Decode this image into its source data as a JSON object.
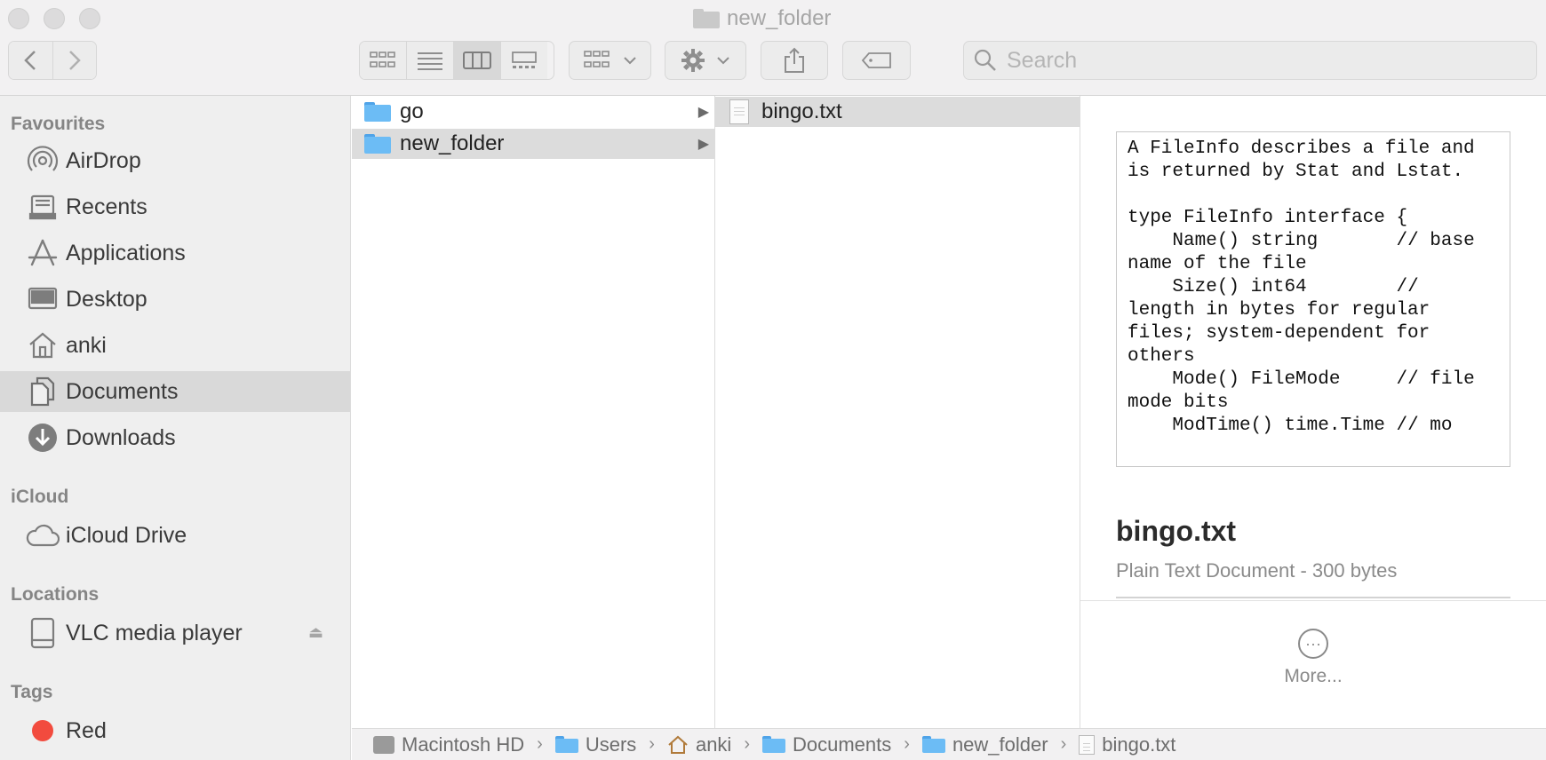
{
  "window": {
    "title": "new_folder"
  },
  "toolbar": {
    "search_placeholder": "Search"
  },
  "sidebar": {
    "sections": [
      {
        "title": "Favourites"
      },
      {
        "title": "iCloud"
      },
      {
        "title": "Locations"
      },
      {
        "title": "Tags"
      }
    ],
    "favourites": [
      {
        "label": "AirDrop",
        "icon": "airdrop-icon"
      },
      {
        "label": "Recents",
        "icon": "recents-icon"
      },
      {
        "label": "Applications",
        "icon": "applications-icon"
      },
      {
        "label": "Desktop",
        "icon": "desktop-icon"
      },
      {
        "label": "anki",
        "icon": "home-icon"
      },
      {
        "label": "Documents",
        "icon": "documents-icon",
        "selected": true
      },
      {
        "label": "Downloads",
        "icon": "downloads-icon"
      }
    ],
    "icloud": [
      {
        "label": "iCloud Drive",
        "icon": "cloud-icon"
      }
    ],
    "locations": [
      {
        "label": "VLC media player",
        "icon": "disk-icon"
      }
    ],
    "tags": [
      {
        "label": "Red",
        "color": "#f24b3e"
      }
    ]
  },
  "columns": {
    "col1": [
      {
        "name": "go"
      },
      {
        "name": "new_folder",
        "selected": true
      }
    ],
    "col2": [
      {
        "name": "bingo.txt",
        "selected": true
      }
    ]
  },
  "preview": {
    "text": "A FileInfo describes a file and\nis returned by Stat and Lstat.\n\ntype FileInfo interface {\n    Name() string       // base\nname of the file\n    Size() int64        //\nlength in bytes for regular\nfiles; system-dependent for\nothers\n    Mode() FileMode     // file\nmode bits\n    ModTime() time.Time // mo",
    "filename": "bingo.txt",
    "kind": "Plain Text Document - 300 bytes",
    "more_label": "More..."
  },
  "pathbar": {
    "items": [
      "Macintosh HD",
      "Users",
      "anki",
      "Documents",
      "new_folder",
      "bingo.txt"
    ]
  },
  "colors": {
    "folder_blue": "#6cbcf5",
    "selection_grey": "#d9d9d9",
    "tag_red": "#f24b3e"
  }
}
